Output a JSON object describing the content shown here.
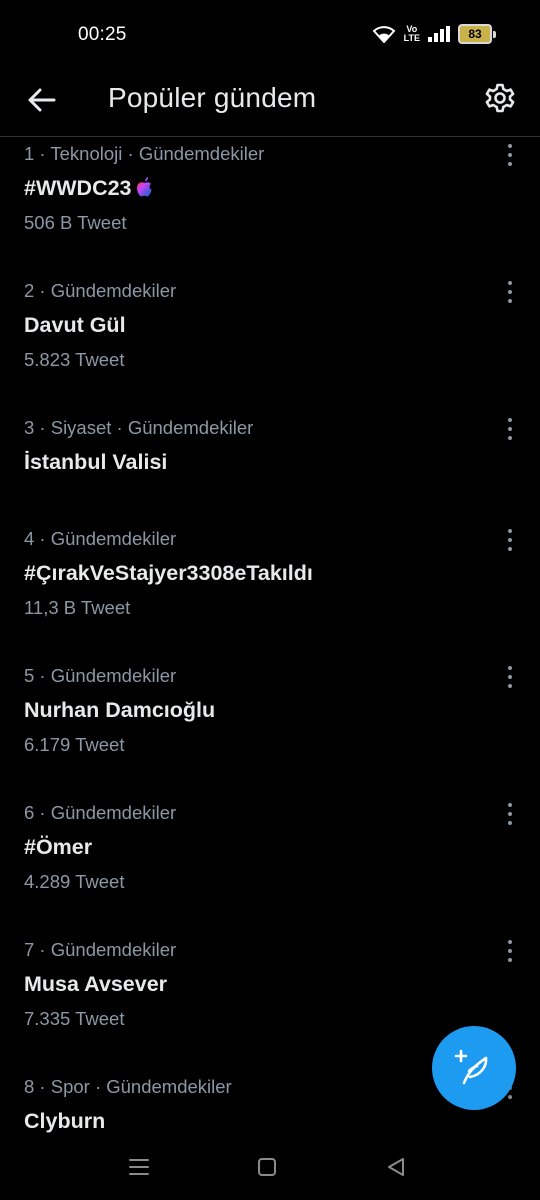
{
  "status_bar": {
    "time": "00:25",
    "network_label_top": "Vo",
    "network_label_bottom": "LTE",
    "battery": "83"
  },
  "header": {
    "title": "Popüler gündem",
    "back_icon": "arrow-left-icon",
    "settings_icon": "gear-icon"
  },
  "trends": [
    {
      "meta": "1 · Teknoloji · Gündemdekiler",
      "name": "#WWDC23",
      "count": "506 B Tweet",
      "emoji": "apple-logo-icon"
    },
    {
      "meta": "2 · Gündemdekiler",
      "name": "Davut Gül",
      "count": "5.823 Tweet"
    },
    {
      "meta": "3 · Siyaset · Gündemdekiler",
      "name": "İstanbul Valisi",
      "count": ""
    },
    {
      "meta": "4 · Gündemdekiler",
      "name": "#ÇırakVeStajyer3308eTakıldı",
      "count": "11,3 B Tweet"
    },
    {
      "meta": "5 · Gündemdekiler",
      "name": "Nurhan Damcıoğlu",
      "count": "6.179 Tweet"
    },
    {
      "meta": "6 · Gündemdekiler",
      "name": "#Ömer",
      "count": "4.289 Tweet"
    },
    {
      "meta": "7 · Gündemdekiler",
      "name": "Musa Avsever",
      "count": "7.335 Tweet"
    },
    {
      "meta": "8 · Spor · Gündemdekiler",
      "name": "Clyburn",
      "count": ""
    }
  ],
  "fab": {
    "icon": "compose-tweet-icon"
  },
  "colors": {
    "background": "#000000",
    "primary_text": "#e7e9ea",
    "secondary_text": "#8b98a5",
    "accent": "#1d9bf0"
  }
}
